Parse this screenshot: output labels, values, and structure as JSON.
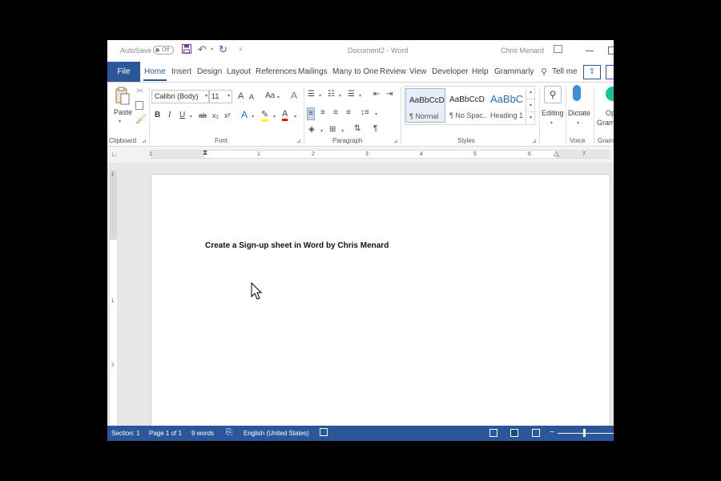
{
  "titlebar": {
    "autosave_label": "AutoSave",
    "autosave_state": "Off",
    "doc_title": "Document2  -  Word",
    "user_name": "Chris Menard"
  },
  "tabs": [
    {
      "label": "Home"
    },
    {
      "label": "Insert"
    },
    {
      "label": "Design"
    },
    {
      "label": "Layout"
    },
    {
      "label": "References"
    },
    {
      "label": "Mailings"
    },
    {
      "label": "Many to One"
    },
    {
      "label": "Review"
    },
    {
      "label": "View"
    },
    {
      "label": "Developer"
    },
    {
      "label": "Help"
    },
    {
      "label": "Grammarly"
    }
  ],
  "file_tab": "File",
  "tell_me": "Tell me",
  "ribbon": {
    "clipboard": {
      "paste_label": "Paste",
      "group_label": "Clipboard"
    },
    "font": {
      "font_name": "Calibri (Body)",
      "font_size": "11",
      "group_label": "Font",
      "bold": "B",
      "italic": "I",
      "underline": "U",
      "strike": "ab",
      "subscript": "x₂",
      "superscript": "x²",
      "grow": "A",
      "shrink": "A",
      "case": "Aa",
      "clear": "A",
      "effects": "A",
      "highlight": "✎",
      "color": "A"
    },
    "paragraph": {
      "group_label": "Paragraph",
      "pilcrow": "¶"
    },
    "styles": {
      "group_label": "Styles",
      "items": [
        {
          "sample": "AaBbCcDc",
          "name": "¶ Normal"
        },
        {
          "sample": "AaBbCcDc",
          "name": "¶ No Spac..."
        },
        {
          "sample": "AaBbC",
          "name": "Heading 1"
        }
      ]
    },
    "editing": {
      "label": "Editing"
    },
    "voice": {
      "label": "Dictate",
      "group_label": "Voice"
    },
    "grammarly": {
      "label_top": "Op",
      "label_bottom": "Gramm",
      "group_label": "Gram"
    }
  },
  "ruler": {
    "numbers": [
      "1",
      "1",
      "2",
      "3",
      "4",
      "5",
      "6",
      "7"
    ]
  },
  "vruler": {
    "numbers": [
      "1",
      "1",
      "2"
    ]
  },
  "document": {
    "text": "Create a Sign-up sheet in Word by Chris Menard"
  },
  "statusbar": {
    "section": "Section: 1",
    "page": "Page 1 of 1",
    "words": "9 words",
    "language": "English (United States)"
  },
  "colors": {
    "accent": "#2b579a",
    "highlight": "#ffff00",
    "font_color": "#ff0000"
  }
}
